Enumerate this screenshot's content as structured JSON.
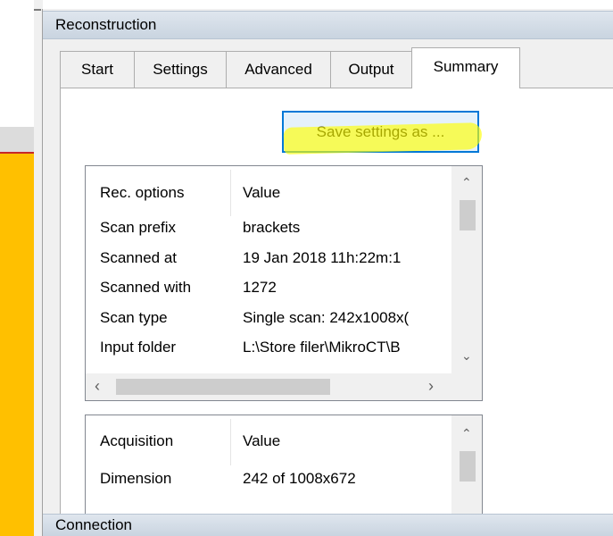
{
  "panel": {
    "title": "Reconstruction"
  },
  "tabs": [
    "Start",
    "Settings",
    "Advanced",
    "Output",
    "Summary"
  ],
  "active_tab": "Summary",
  "save_button": {
    "label": "Save settings as ..."
  },
  "rec_options_list": {
    "headers": [
      "Rec. options",
      "Value"
    ],
    "rows": [
      {
        "key": "Scan prefix",
        "value": "brackets"
      },
      {
        "key": "Scanned at",
        "value": "19 Jan 2018  11h:22m:1"
      },
      {
        "key": "Scanned with",
        "value": "1272"
      },
      {
        "key": "Scan type",
        "value": "Single scan: 242x1008x("
      },
      {
        "key": "Input folder",
        "value": "L:\\Store filer\\MikroCT\\B"
      }
    ]
  },
  "acquisition_list": {
    "headers": [
      "Acquisition",
      "Value"
    ],
    "rows": [
      {
        "key": "Dimension",
        "value": "242 of 1008x672"
      }
    ]
  },
  "connection_panel": {
    "title": "Connection"
  },
  "colors": {
    "accent": "#0078d7",
    "left_strip": "#ffc000",
    "highlight": "#ffff00"
  }
}
